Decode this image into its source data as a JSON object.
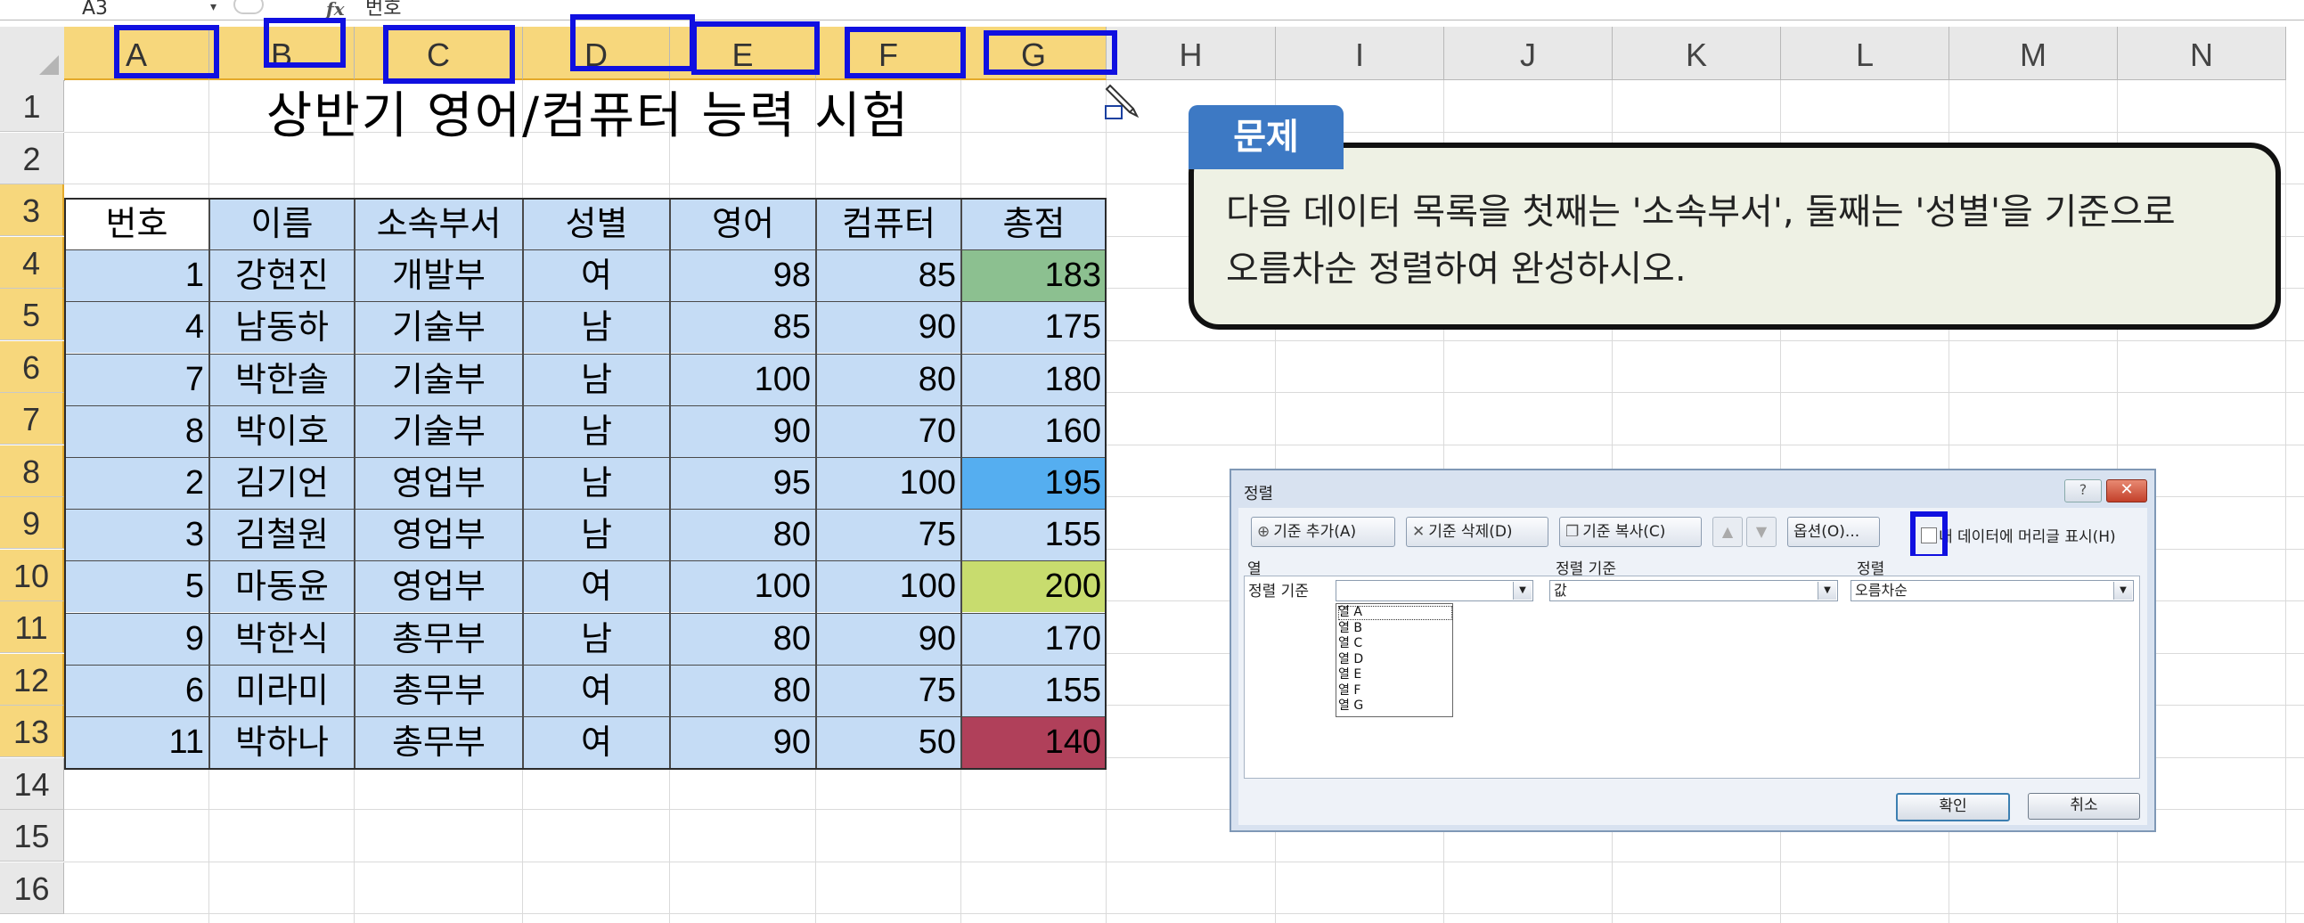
{
  "formula_bar": {
    "name_box": "A3",
    "name_box_arrow": "▾",
    "fx": "fx",
    "content": "번호"
  },
  "columns": [
    "A",
    "B",
    "C",
    "D",
    "E",
    "F",
    "G",
    "H",
    "I",
    "J",
    "K",
    "L",
    "M",
    "N"
  ],
  "rows": [
    "1",
    "2",
    "3",
    "4",
    "5",
    "6",
    "7",
    "8",
    "9",
    "10",
    "11",
    "12",
    "13",
    "14",
    "15",
    "16"
  ],
  "sheet": {
    "title": "상반기 영어/컴퓨터 능력 시험",
    "headers": [
      "번호",
      "이름",
      "소속부서",
      "성별",
      "영어",
      "컴퓨터",
      "총점"
    ],
    "data": [
      [
        "1",
        "강현진",
        "개발부",
        "여",
        "98",
        "85",
        "183"
      ],
      [
        "4",
        "남동하",
        "기술부",
        "남",
        "85",
        "90",
        "175"
      ],
      [
        "7",
        "박한솔",
        "기술부",
        "남",
        "100",
        "80",
        "180"
      ],
      [
        "8",
        "박이호",
        "기술부",
        "남",
        "90",
        "70",
        "160"
      ],
      [
        "2",
        "김기언",
        "영업부",
        "남",
        "95",
        "100",
        "195"
      ],
      [
        "3",
        "김철원",
        "영업부",
        "남",
        "80",
        "75",
        "155"
      ],
      [
        "5",
        "마동윤",
        "영업부",
        "여",
        "100",
        "100",
        "200"
      ],
      [
        "9",
        "박한식",
        "총무부",
        "남",
        "80",
        "90",
        "170"
      ],
      [
        "6",
        "미라미",
        "총무부",
        "여",
        "80",
        "75",
        "155"
      ],
      [
        "11",
        "박하나",
        "총무부",
        "여",
        "90",
        "50",
        "140"
      ]
    ],
    "total_colors": [
      "#8cc090",
      "",
      "",
      "",
      "#55aef0",
      "",
      "#c8dc6e",
      "",
      "",
      "#b0405a"
    ],
    "data_fill": "#c5dcf5",
    "header_fill_selected": "#f7d77c"
  },
  "callout": {
    "tag": "문제",
    "line1": "다음 데이터 목록을 첫째는 '소속부서', 둘째는 '성별'을 기준으로",
    "line2": "오름차순 정렬하여 완성하시오.",
    "tag_color": "#3d79c4",
    "box_color": "#eef1e4"
  },
  "dialog": {
    "title": "정렬",
    "help": "?",
    "close": "✕",
    "toolbar": {
      "add": "기준 추가(A)",
      "delete": "기준 삭제(D)",
      "copy": "기준 복사(C)",
      "up": "▲",
      "down": "▼",
      "options": "옵션(O)...",
      "header_checkbox": "내 데이터에 머리글 표시(H)"
    },
    "grid_headers": {
      "column": "열",
      "sort_on": "정렬 기준",
      "order": "정렬"
    },
    "row": {
      "label": "정렬 기준",
      "column_value": "",
      "sort_on_value": "값",
      "order_value": "오름차순"
    },
    "dropdown_items": [
      "열 A",
      "열 B",
      "열 C",
      "열 D",
      "열 E",
      "열 F",
      "열 G"
    ],
    "ok": "확인",
    "cancel": "취소"
  }
}
